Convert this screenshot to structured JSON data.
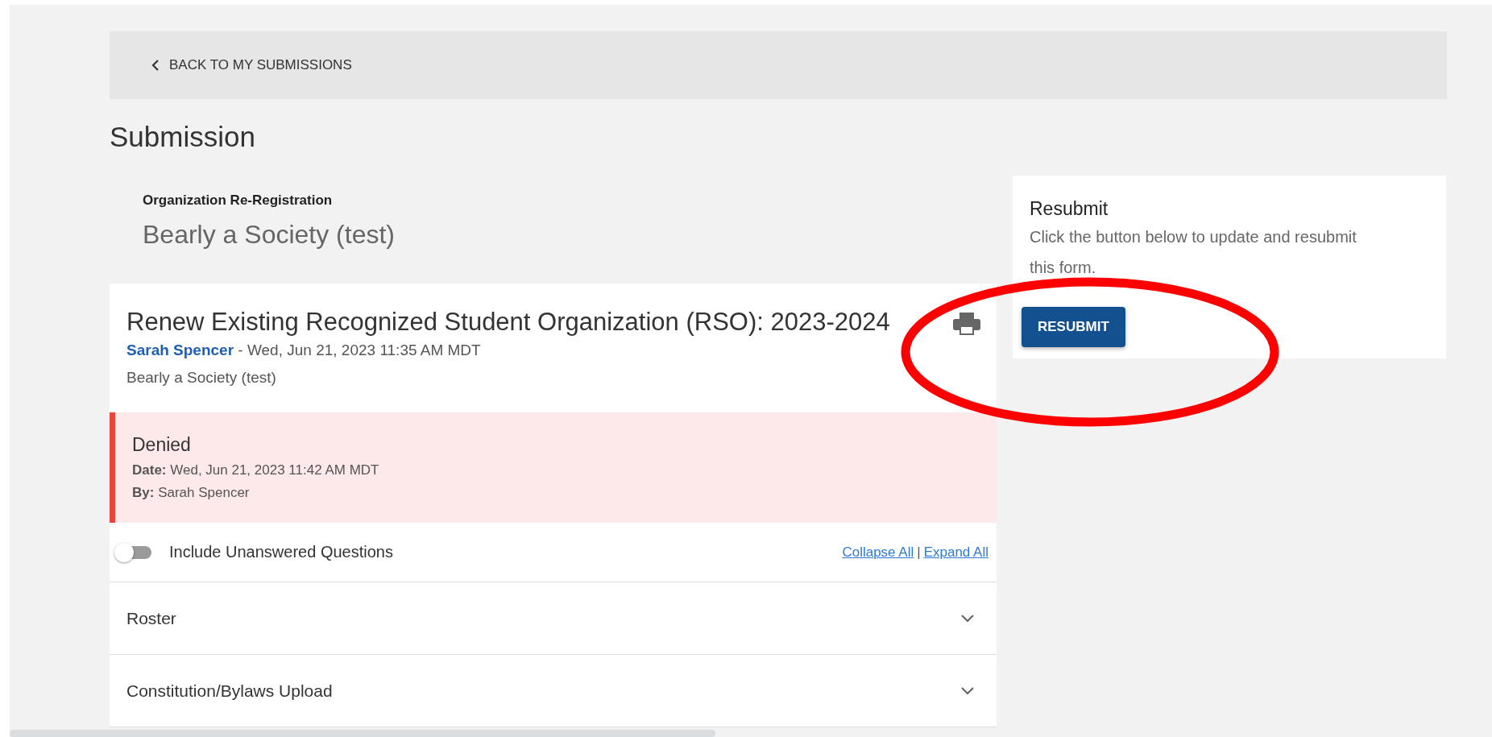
{
  "back_link": {
    "label": "BACK TO MY SUBMISSIONS"
  },
  "page_title": "Submission",
  "organization": {
    "label": "Organization Re-Registration",
    "name": "Bearly a Society (test)"
  },
  "submission": {
    "title": "Renew Existing Recognized Student Organization (RSO): 2023-2024",
    "author": "Sarah Spencer",
    "submitted": "- Wed, Jun 21, 2023 11:35 AM MDT",
    "organization": "Bearly a Society (test)"
  },
  "status": {
    "label": "Denied",
    "date_label": "Date:",
    "date": "Wed, Jun 21, 2023 11:42 AM MDT",
    "by_label": "By:",
    "by": "Sarah Spencer"
  },
  "include_unanswered": {
    "label": "Include Unanswered Questions",
    "on": false
  },
  "collapse_all": "Collapse All",
  "separator": "|",
  "expand_all": "Expand All",
  "sections": [
    {
      "title": "Roster",
      "expanded": false
    },
    {
      "title": "Constitution/Bylaws Upload",
      "expanded": false
    }
  ],
  "resubmit_panel": {
    "title": "Resubmit",
    "text": "Click the button below to update and resubmit this form.",
    "button": "RESUBMIT"
  }
}
